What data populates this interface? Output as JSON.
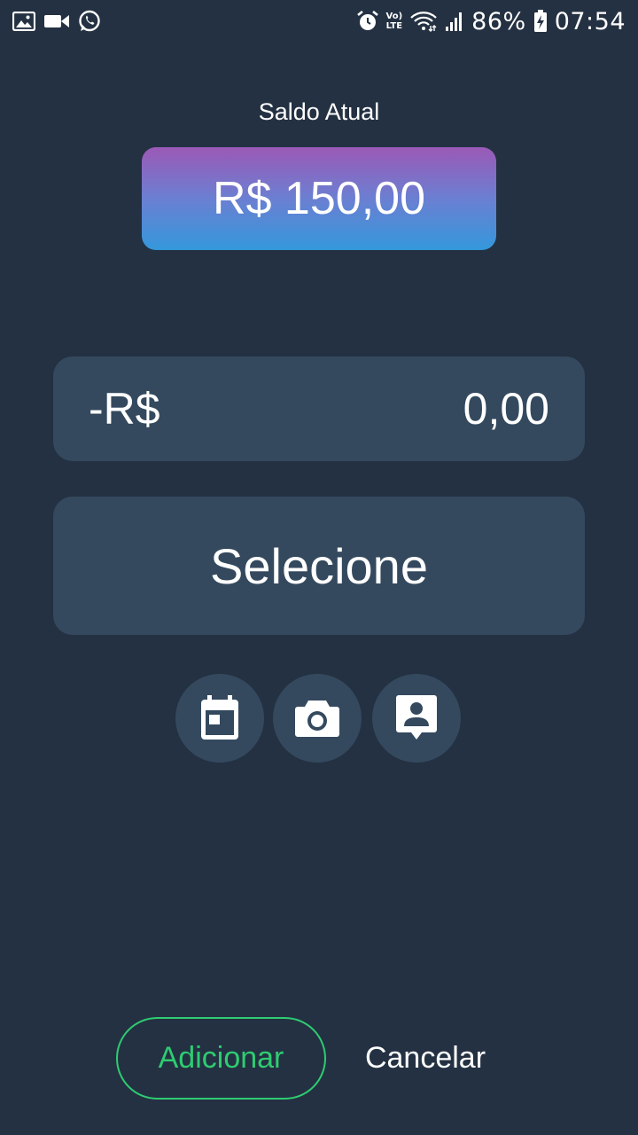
{
  "status_bar": {
    "battery": "86%",
    "time": "07:54",
    "lte_top": "Vo)",
    "lte_bottom": "LTE"
  },
  "balance": {
    "label": "Saldo Atual",
    "value": "R$ 150,00"
  },
  "amount": {
    "prefix": "-R$",
    "value": "0,00"
  },
  "category_select": {
    "placeholder": "Selecione"
  },
  "actions": {
    "add_label": "Adicionar",
    "cancel_label": "Cancelar"
  },
  "icons": [
    "image-icon",
    "video-camera-icon",
    "whatsapp-icon",
    "alarm-icon",
    "wifi-icon",
    "signal-icon",
    "battery-icon",
    "calendar-icon",
    "camera-icon",
    "contact-icon"
  ],
  "colors": {
    "background": "#243142",
    "field": "#34495e",
    "gradient_top": "#9b59b6",
    "gradient_bottom": "#3498db",
    "accent_green": "#2ecc71"
  }
}
